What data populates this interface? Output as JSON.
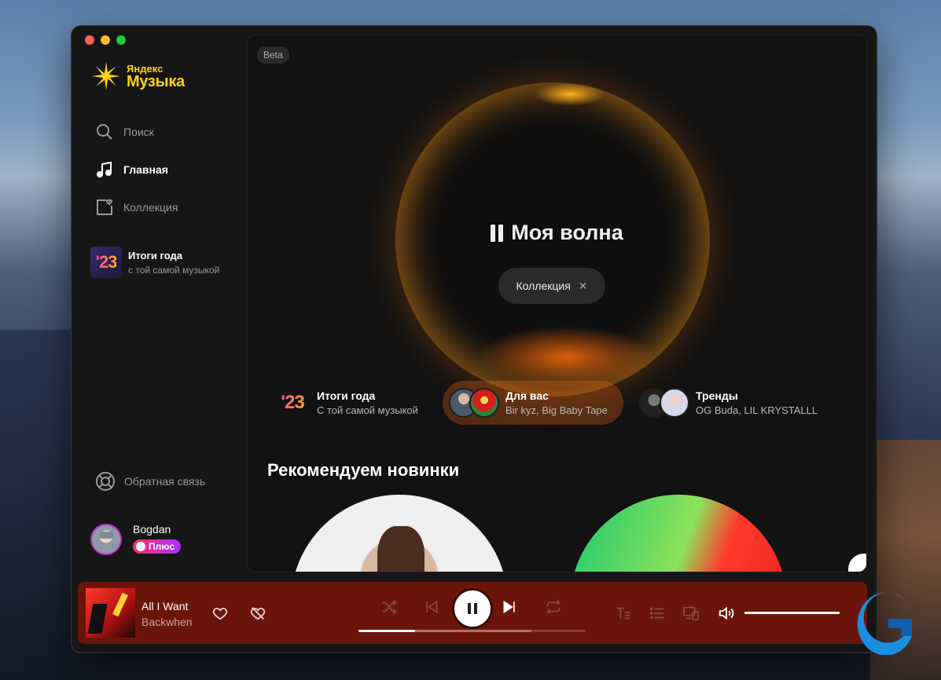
{
  "app": {
    "logo_small": "Яндекс",
    "logo_big": "Музыка",
    "brand_color": "#ffd31a"
  },
  "sidebar": {
    "nav": [
      {
        "label": "Поиск",
        "icon": "search-icon",
        "active": false
      },
      {
        "label": "Главная",
        "icon": "music-note-icon",
        "active": true
      },
      {
        "label": "Коллекция",
        "icon": "collection-heart-icon",
        "active": false
      }
    ],
    "year_card": {
      "badge": "'23",
      "title": "Итоги года",
      "subtitle": "с той самой музыкой"
    },
    "feedback": "Обратная связь",
    "user": {
      "name": "Bogdan",
      "plus_label": "Плюс"
    }
  },
  "main": {
    "beta_label": "Beta",
    "wave_title": "Моя волна",
    "filter_chip": "Коллекция",
    "tiles": [
      {
        "badge": "'23",
        "title": "Итоги года",
        "subtitle": "С той самой музыкой"
      },
      {
        "title": "Для вас",
        "subtitle": "Bir kyz, Big Baby Tape"
      },
      {
        "title": "Тренды",
        "subtitle": "OG Buda, LIL KRYSTALLL"
      }
    ],
    "section_title": "Рекомендуем новинки"
  },
  "player": {
    "track_title": "All I Want",
    "artist": "Backwhen",
    "progress_fraction": 0.25,
    "buffered_fraction": 0.76,
    "volume_fraction": 1.0,
    "background_color": "#6b150a"
  }
}
